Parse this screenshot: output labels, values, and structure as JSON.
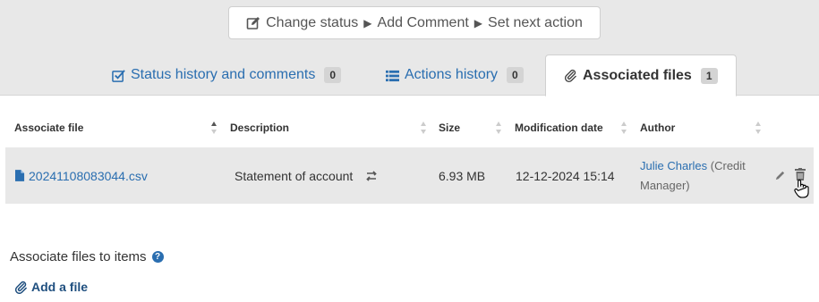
{
  "workflow": {
    "change_status": "Change status",
    "add_comment": "Add Comment",
    "set_next_action": "Set next action"
  },
  "tabs": [
    {
      "label": "Status history and comments",
      "count": "0",
      "icon": "check-square-icon"
    },
    {
      "label": "Actions history",
      "count": "0",
      "icon": "list-icon"
    },
    {
      "label": "Associated files",
      "count": "1",
      "icon": "paperclip-icon"
    }
  ],
  "table": {
    "columns": [
      "Associate file",
      "Description",
      "Size",
      "Modification date",
      "Author"
    ],
    "rows": [
      {
        "file": "20241108083044.csv",
        "description": "Statement of account",
        "size": "6.93 MB",
        "date": "12-12-2024 15:14",
        "author_name": "Julie Charles",
        "author_role_line1": "(Credit",
        "author_role_line2": "Manager)"
      }
    ]
  },
  "associate_section": {
    "title": "Associate files to items",
    "help": "?",
    "add_file": "Add a file"
  },
  "colors": {
    "link": "#2a6eb0",
    "band": "#e8e8e8",
    "row_bg": "#e8e8e8"
  }
}
